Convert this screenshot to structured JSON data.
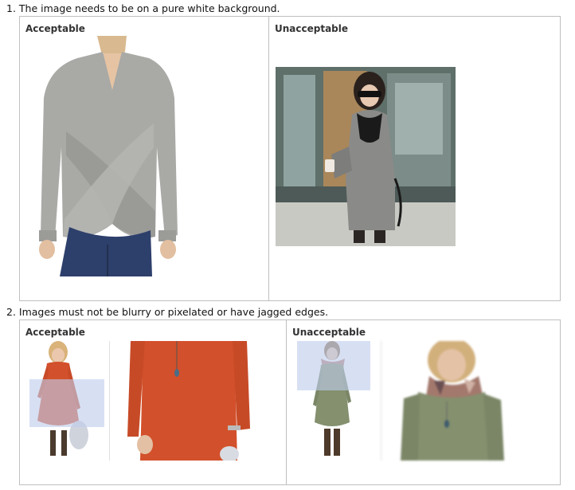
{
  "rules": [
    {
      "title": "1. The image needs to be on a pure white background.",
      "acceptable_label": "Acceptable",
      "unacceptable_label": "Unacceptable"
    },
    {
      "title": "2. Images must not be blurry or pixelated or have jagged edges.",
      "acceptable_label": "Acceptable",
      "unacceptable_label": "Unacceptable"
    }
  ],
  "colors": {
    "border": "#bfbfbf",
    "sweater_gray": "#a9a9a6",
    "dress_orange": "#d2502b",
    "dress_olive": "#84906e",
    "zoom_highlight": "#becdeb"
  }
}
